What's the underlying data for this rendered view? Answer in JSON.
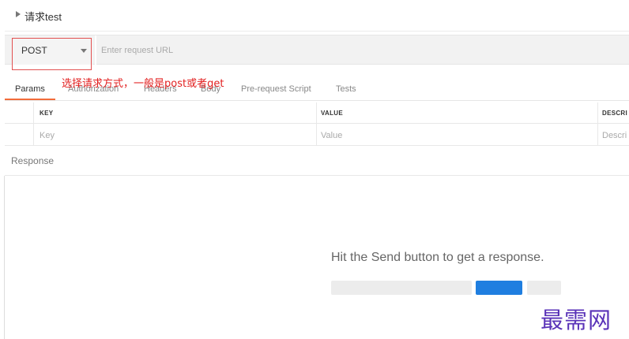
{
  "request": {
    "name": "请求test"
  },
  "url_bar": {
    "method": "POST",
    "url_placeholder": "Enter request URL",
    "url_value": ""
  },
  "tabs": [
    {
      "label": "Params",
      "active": true
    },
    {
      "label": "Authorization",
      "active": false
    },
    {
      "label": "Headers",
      "active": false
    },
    {
      "label": "Body",
      "active": false
    },
    {
      "label": "Pre-request Script",
      "active": false
    },
    {
      "label": "Tests",
      "active": false
    }
  ],
  "annotation": "选择请求方式，一般是post或者get",
  "params": {
    "columns": [
      "KEY",
      "VALUE",
      "DESCRI"
    ],
    "row_placeholders": [
      "Key",
      "Value",
      "Descri"
    ]
  },
  "response": {
    "title": "Response",
    "empty_message": "Hit the Send button to get a response."
  },
  "watermark": "最需网",
  "colors": {
    "accent_underline": "#f26b3a",
    "annotation_red": "#e21f1f",
    "send_blue": "#1f7ee0",
    "watermark_purple": "#5a33b8"
  }
}
